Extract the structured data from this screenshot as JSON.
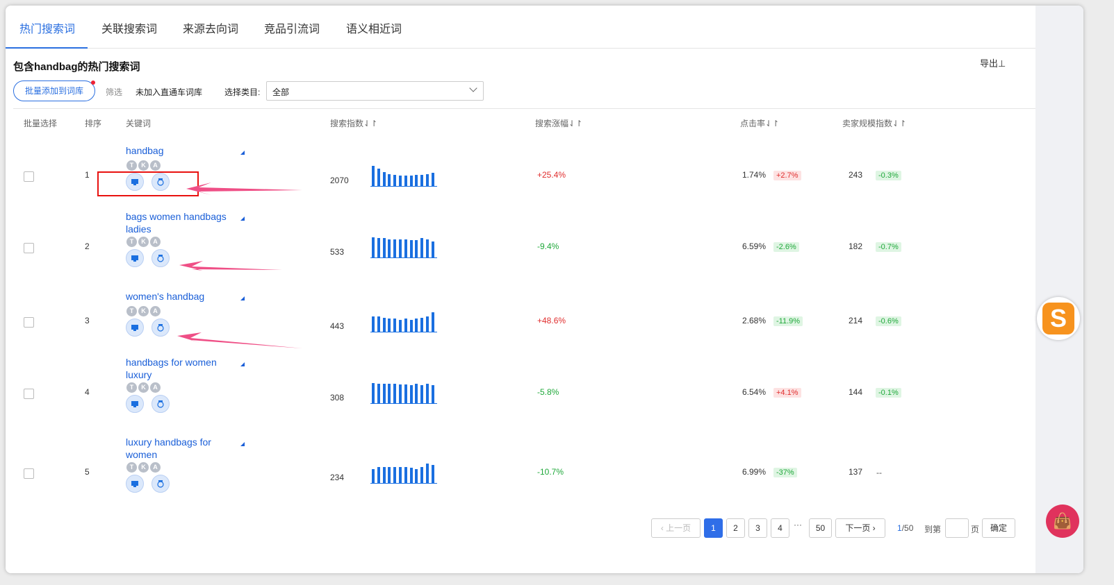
{
  "tabs": [
    "热门搜索词",
    "关联搜索词",
    "来源去向词",
    "竞品引流词",
    "语义相近词"
  ],
  "title": "包含handbag的热门搜索词",
  "export_label": "导出⊥",
  "toolbar": {
    "batch_add": "批量添加到词库",
    "filter": "筛选",
    "filter_option": "未加入直通车词库",
    "category_label": "选择类目:",
    "category_value": "全部"
  },
  "columns": [
    "批量选择",
    "排序",
    "关键词",
    "搜索指数",
    "搜索涨幅",
    "点击率",
    "卖家规模指数"
  ],
  "sort_icon": "⇃↾",
  "tka": [
    "T",
    "K",
    "A"
  ],
  "rows": [
    {
      "rank": "1",
      "keyword": "handbag",
      "search_index": "2070",
      "growth": "+25.4%",
      "growth_dir": "up",
      "ctr": "1.74%",
      "ctr_change": "+2.7%",
      "ctr_dir": "up",
      "seller": "243",
      "seller_change": "-0.3%",
      "seller_dir": "down",
      "spark": [
        1.0,
        0.85,
        0.7,
        0.6,
        0.55,
        0.5,
        0.52,
        0.5,
        0.55,
        0.55,
        0.6,
        0.65
      ]
    },
    {
      "rank": "2",
      "keyword": "bags women handbags ladies",
      "search_index": "533",
      "growth": "-9.4%",
      "growth_dir": "down",
      "ctr": "6.59%",
      "ctr_change": "-2.6%",
      "ctr_dir": "down",
      "seller": "182",
      "seller_change": "-0.7%",
      "seller_dir": "down",
      "spark": [
        1.0,
        0.95,
        0.95,
        0.9,
        0.9,
        0.9,
        0.88,
        0.85,
        0.85,
        0.95,
        0.9,
        0.8
      ]
    },
    {
      "rank": "3",
      "keyword": "women's handbag",
      "search_index": "443",
      "growth": "+48.6%",
      "growth_dir": "up",
      "ctr": "2.68%",
      "ctr_change": "-11.9%",
      "ctr_dir": "down",
      "seller": "214",
      "seller_change": "-0.6%",
      "seller_dir": "down",
      "spark": [
        0.75,
        0.75,
        0.7,
        0.65,
        0.65,
        0.6,
        0.65,
        0.6,
        0.65,
        0.7,
        0.75,
        0.95
      ]
    },
    {
      "rank": "4",
      "keyword": "handbags for women luxury",
      "search_index": "308",
      "growth": "-5.8%",
      "growth_dir": "down",
      "ctr": "6.54%",
      "ctr_change": "+4.1%",
      "ctr_dir": "up",
      "seller": "144",
      "seller_change": "-0.1%",
      "seller_dir": "down",
      "spark": [
        1.0,
        0.98,
        0.97,
        0.95,
        0.95,
        0.93,
        0.92,
        0.9,
        0.95,
        0.88,
        0.95,
        0.9
      ]
    },
    {
      "rank": "5",
      "keyword": "luxury handbags for women",
      "search_index": "234",
      "growth": "-10.7%",
      "growth_dir": "down",
      "ctr": "6.99%",
      "ctr_change": "-37%",
      "ctr_dir": "down",
      "seller": "137",
      "seller_change": "--",
      "seller_dir": "none",
      "spark": [
        0.7,
        0.78,
        0.8,
        0.8,
        0.8,
        0.8,
        0.78,
        0.75,
        0.7,
        0.8,
        0.95,
        0.9
      ]
    }
  ],
  "pagination": {
    "prev": "上一页",
    "pages": [
      "1",
      "2",
      "3",
      "4"
    ],
    "ellipsis": "···",
    "last": "50",
    "next": "下一页",
    "current": "1",
    "total": "/50",
    "goto": "到第",
    "page_unit": "页",
    "confirm": "确定"
  },
  "icon_names": [
    "desktop-icon",
    "badge-icon",
    "sort-icon",
    "dropdown-chevron-icon",
    "s-app-icon",
    "bag-icon"
  ],
  "colors": {
    "accent": "#2a6fe0",
    "up": "#e02d2d",
    "down": "#1fa83a",
    "annotation": "#e8110f",
    "arrow": "#ef4f86"
  }
}
